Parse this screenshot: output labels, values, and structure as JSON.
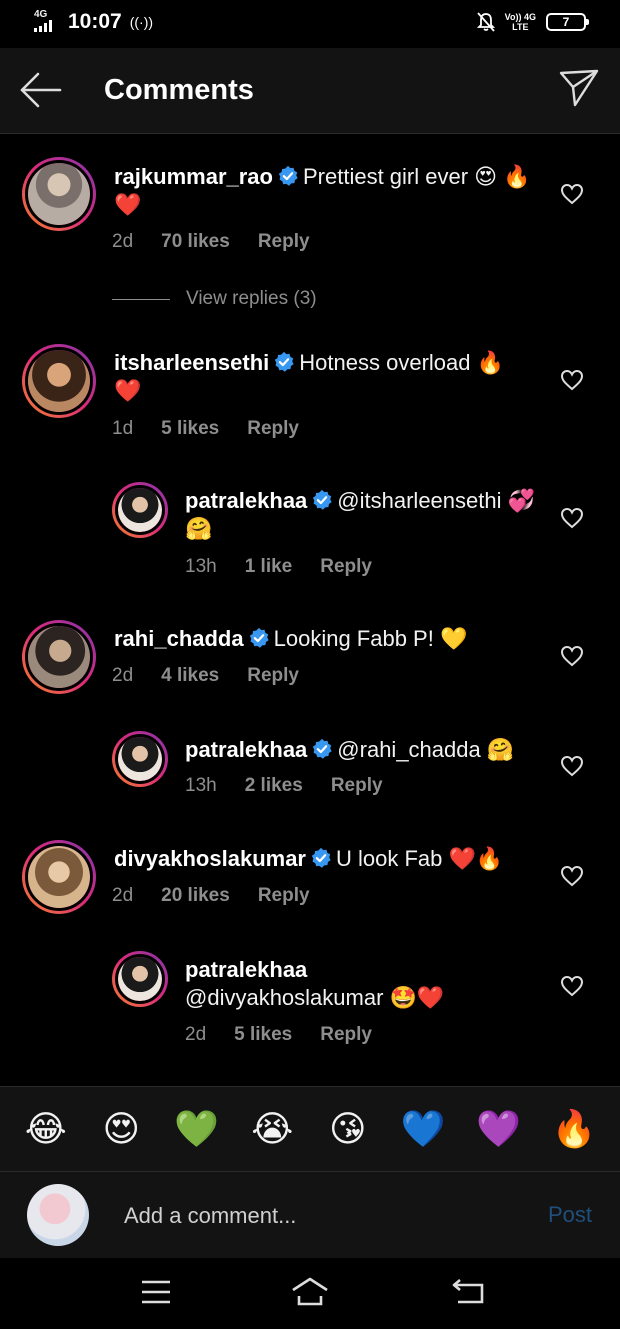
{
  "status_bar": {
    "network_type": "4G",
    "time": "10:07",
    "hotspot_icon": "hotspot-icon",
    "volte_line1": "Vo)) 4G",
    "volte_line2": "LTE",
    "battery": "7"
  },
  "header": {
    "title": "Comments",
    "back_icon": "arrow-left-icon",
    "share_icon": "send-icon"
  },
  "comments": [
    {
      "username": "rajkummar_rao",
      "text": "Prettiest girl ever 😍 🔥❤️",
      "time": "2d",
      "likes": "70 likes",
      "reply": "Reply",
      "view_replies": "View replies (3)"
    },
    {
      "username": "itsharleensethi",
      "text": "Hotness overload 🔥 ❤️",
      "time": "1d",
      "likes": "5 likes",
      "reply": "Reply"
    },
    {
      "username": "patralekhaa",
      "text": "@itsharleensethi 💞🤗",
      "time": "13h",
      "likes": "1 like",
      "reply": "Reply"
    },
    {
      "username": "rahi_chadda",
      "text": "Looking Fabb P! 💛",
      "time": "2d",
      "likes": "4 likes",
      "reply": "Reply"
    },
    {
      "username": "patralekhaa",
      "text": "@rahi_chadda 🤗",
      "time": "13h",
      "likes": "2 likes",
      "reply": "Reply"
    },
    {
      "username": "divyakhoslakumar",
      "text": "U look Fab ❤️🔥",
      "time": "2d",
      "likes": "20 likes",
      "reply": "Reply"
    },
    {
      "username": "patralekhaa",
      "text": "@divyakhoslakumar 🤩❤️",
      "time": "2d",
      "likes": "5 likes",
      "reply": "Reply"
    }
  ],
  "emoji_bar": [
    "😂",
    "😍",
    "💚",
    "😭",
    "😘",
    "💙",
    "💜",
    "🔥"
  ],
  "comment_input": {
    "placeholder": "Add a comment...",
    "post_label": "Post"
  },
  "nav": {
    "menu_icon": "menu-icon",
    "home_icon": "home-icon",
    "back_icon": "back-icon"
  },
  "colors": {
    "background": "#000000",
    "header": "#131313",
    "muted_text": "#8e8e8e",
    "verified_blue": "#3897f0",
    "post_disabled": "#1f4f7a"
  }
}
